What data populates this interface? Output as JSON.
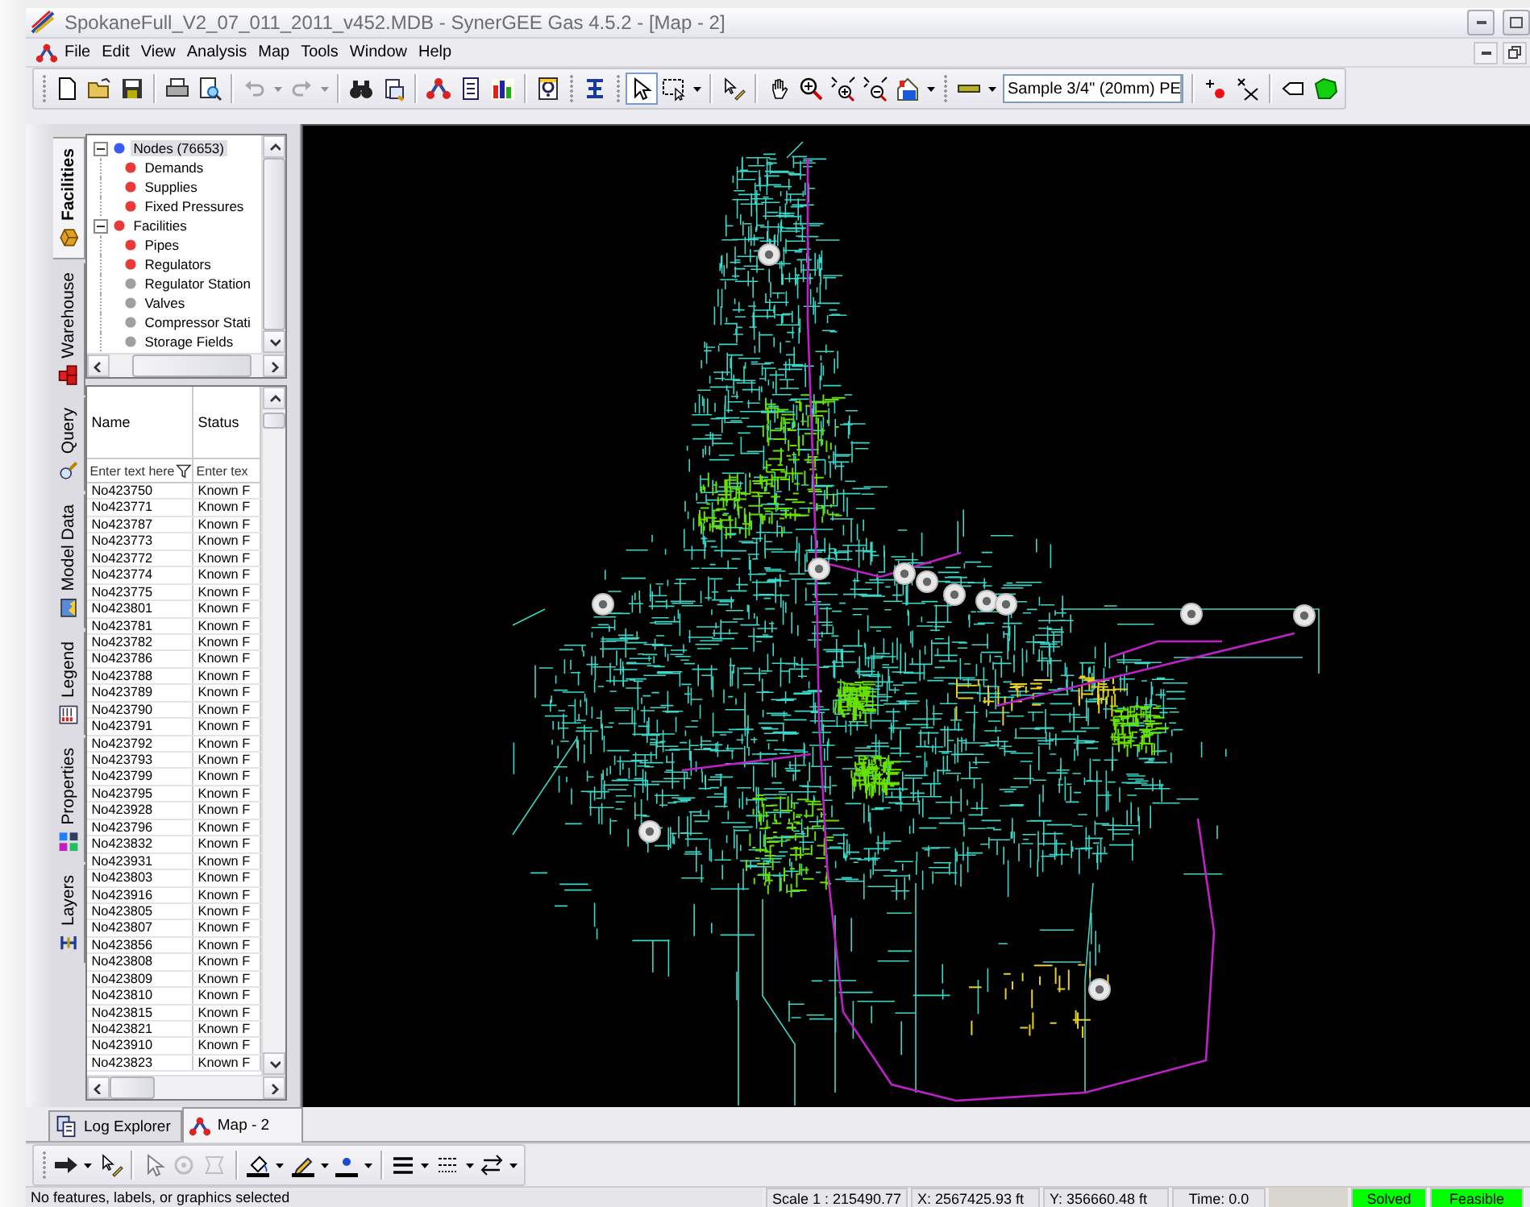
{
  "window": {
    "title": "SpokaneFull_V2_07_011_2011_v452.MDB - SynerGEE Gas 4.5.2 - [Map - 2]"
  },
  "menu": [
    "File",
    "Edit",
    "View",
    "Analysis",
    "Map",
    "Tools",
    "Window",
    "Help"
  ],
  "toolbar": [
    {
      "kind": "grip"
    },
    {
      "kind": "new",
      "disabled": false,
      "pressed": false
    },
    {
      "kind": "open",
      "disabled": false,
      "pressed": false
    },
    {
      "kind": "save",
      "disabled": false,
      "pressed": false
    },
    {
      "kind": "sep"
    },
    {
      "kind": "print",
      "disabled": false,
      "pressed": false
    },
    {
      "kind": "preview",
      "disabled": false,
      "pressed": false
    },
    {
      "kind": "sep"
    },
    {
      "kind": "undo",
      "disabled": true,
      "pressed": false
    },
    {
      "kind": "caret",
      "disabled": true,
      "pressed": false
    },
    {
      "kind": "redo",
      "disabled": true,
      "pressed": false
    },
    {
      "kind": "caret",
      "disabled": true,
      "pressed": false
    },
    {
      "kind": "sep"
    },
    {
      "kind": "binoculars",
      "disabled": false,
      "pressed": false
    },
    {
      "kind": "find-replace",
      "disabled": false,
      "pressed": false
    },
    {
      "kind": "sep"
    },
    {
      "kind": "network",
      "disabled": false,
      "pressed": false
    },
    {
      "kind": "report",
      "disabled": false,
      "pressed": false
    },
    {
      "kind": "chart",
      "disabled": false,
      "pressed": false
    },
    {
      "kind": "sep"
    },
    {
      "kind": "help",
      "disabled": false,
      "pressed": false
    },
    {
      "kind": "grip"
    },
    {
      "kind": "ibeam",
      "disabled": false,
      "pressed": false
    },
    {
      "kind": "grip"
    },
    {
      "kind": "pointer",
      "disabled": false,
      "pressed": true
    },
    {
      "kind": "select-box",
      "disabled": false,
      "pressed": false
    },
    {
      "kind": "caret",
      "disabled": false,
      "pressed": false
    },
    {
      "kind": "sep"
    },
    {
      "kind": "edit-pointer",
      "disabled": false,
      "pressed": false
    },
    {
      "kind": "sep"
    },
    {
      "kind": "pan",
      "disabled": false,
      "pressed": false
    },
    {
      "kind": "zoom-in",
      "disabled": false,
      "pressed": false
    },
    {
      "kind": "zoom-extent-in",
      "disabled": false,
      "pressed": false
    },
    {
      "kind": "zoom-extent-out",
      "disabled": false,
      "pressed": false
    },
    {
      "kind": "home",
      "disabled": false,
      "pressed": false
    },
    {
      "kind": "caret",
      "disabled": false,
      "pressed": false
    },
    {
      "kind": "grip"
    },
    {
      "kind": "pipe",
      "disabled": false,
      "pressed": false
    },
    {
      "kind": "caret",
      "disabled": false,
      "pressed": false
    },
    {
      "kind": "combo",
      "value": "Sample  3/4\" (20mm) PE"
    },
    {
      "kind": "sep"
    },
    {
      "kind": "add-node",
      "disabled": false,
      "pressed": false
    },
    {
      "kind": "delete-node",
      "disabled": false,
      "pressed": false
    },
    {
      "kind": "sep"
    },
    {
      "kind": "tag",
      "disabled": false,
      "pressed": false
    },
    {
      "kind": "polygon",
      "disabled": false,
      "pressed": false
    }
  ],
  "side_tabs": [
    {
      "label": "Facilities",
      "selected": true
    },
    {
      "label": "Warehouse",
      "selected": false
    },
    {
      "label": "Query",
      "selected": false
    },
    {
      "label": "Model Data",
      "selected": false
    },
    {
      "label": "Legend",
      "selected": false
    },
    {
      "label": "Properties",
      "selected": false
    },
    {
      "label": "Layers",
      "selected": false
    }
  ],
  "tree": [
    {
      "label": "Nodes (76653)",
      "color": "#3a5cf0",
      "expanded": true,
      "selected": true,
      "children": [
        {
          "label": "Demands",
          "color": "#e83a3a",
          "selected": false
        },
        {
          "label": "Supplies",
          "color": "#e83a3a",
          "selected": false
        },
        {
          "label": "Fixed Pressures",
          "color": "#e83a3a",
          "selected": false
        }
      ]
    },
    {
      "label": "Facilities",
      "color": "#e83a3a",
      "expanded": true,
      "selected": false,
      "children": [
        {
          "label": "Pipes",
          "color": "#e83a3a",
          "selected": false
        },
        {
          "label": "Regulators",
          "color": "#e83a3a",
          "selected": false
        },
        {
          "label": "Regulator Station",
          "color": "#a0a0a0",
          "selected": false
        },
        {
          "label": "Valves",
          "color": "#a0a0a0",
          "selected": false
        },
        {
          "label": "Compressor Stati",
          "color": "#a0a0a0",
          "selected": false
        },
        {
          "label": "Storage Fields",
          "color": "#a0a0a0",
          "selected": false
        }
      ]
    }
  ],
  "grid": {
    "columns": [
      {
        "label": "Name",
        "placeholder": "Enter text here"
      },
      {
        "label": "Status",
        "placeholder": "Enter tex"
      }
    ],
    "rows": [
      [
        "No423750",
        "Known F"
      ],
      [
        "No423771",
        "Known F"
      ],
      [
        "No423787",
        "Known F"
      ],
      [
        "No423773",
        "Known F"
      ],
      [
        "No423772",
        "Known F"
      ],
      [
        "No423774",
        "Known F"
      ],
      [
        "No423775",
        "Known F"
      ],
      [
        "No423801",
        "Known F"
      ],
      [
        "No423781",
        "Known F"
      ],
      [
        "No423782",
        "Known F"
      ],
      [
        "No423786",
        "Known F"
      ],
      [
        "No423788",
        "Known F"
      ],
      [
        "No423789",
        "Known F"
      ],
      [
        "No423790",
        "Known F"
      ],
      [
        "No423791",
        "Known F"
      ],
      [
        "No423792",
        "Known F"
      ],
      [
        "No423793",
        "Known F"
      ],
      [
        "No423799",
        "Known F"
      ],
      [
        "No423795",
        "Known F"
      ],
      [
        "No423928",
        "Known F"
      ],
      [
        "No423796",
        "Known F"
      ],
      [
        "No423832",
        "Known F"
      ],
      [
        "No423931",
        "Known F"
      ],
      [
        "No423803",
        "Known F"
      ],
      [
        "No423916",
        "Known F"
      ],
      [
        "No423805",
        "Known F"
      ],
      [
        "No423807",
        "Known F"
      ],
      [
        "No423856",
        "Known F"
      ],
      [
        "No423808",
        "Known F"
      ],
      [
        "No423809",
        "Known F"
      ],
      [
        "No423810",
        "Known F"
      ],
      [
        "No423815",
        "Known F"
      ],
      [
        "No423821",
        "Known F"
      ],
      [
        "No423910",
        "Known F"
      ],
      [
        "No423823",
        "Known F"
      ]
    ]
  },
  "doc_tabs": [
    {
      "label": "Log Explorer",
      "selected": false
    },
    {
      "label": "Map - 2",
      "selected": true
    }
  ],
  "drawing_toolbar": [
    {
      "kind": "grip"
    },
    {
      "kind": "arrow",
      "disabled": false,
      "pressed": false
    },
    {
      "kind": "caret",
      "disabled": false,
      "pressed": false
    },
    {
      "kind": "edit-pointer",
      "disabled": false,
      "pressed": false
    },
    {
      "kind": "sep"
    },
    {
      "kind": "pointer",
      "disabled": true,
      "pressed": false
    },
    {
      "kind": "rotate",
      "disabled": true,
      "pressed": false
    },
    {
      "kind": "reshape",
      "disabled": true,
      "pressed": false
    },
    {
      "kind": "sep"
    },
    {
      "kind": "fill",
      "disabled": false,
      "pressed": false
    },
    {
      "kind": "caret",
      "disabled": false,
      "pressed": false
    },
    {
      "kind": "line-color",
      "disabled": false,
      "pressed": false
    },
    {
      "kind": "caret",
      "disabled": false,
      "pressed": false
    },
    {
      "kind": "point",
      "disabled": false,
      "pressed": false
    },
    {
      "kind": "caret",
      "disabled": false,
      "pressed": false
    },
    {
      "kind": "sep"
    },
    {
      "kind": "line-weight",
      "disabled": false,
      "pressed": false
    },
    {
      "kind": "caret",
      "disabled": false,
      "pressed": false
    },
    {
      "kind": "dash",
      "disabled": false,
      "pressed": false
    },
    {
      "kind": "caret",
      "disabled": false,
      "pressed": false
    },
    {
      "kind": "arrow-style",
      "disabled": false,
      "pressed": false
    },
    {
      "kind": "caret",
      "disabled": false,
      "pressed": false
    }
  ],
  "status_bar": [
    {
      "text": "No features, labels, or graphics selected",
      "color": "#e6e5ea"
    },
    {
      "text": "Scale  1 : 215490.77",
      "color": "#e6e5ea"
    },
    {
      "text": "X: 2567425.93 ft",
      "color": "#e6e5ea"
    },
    {
      "text": "Y: 356660.48 ft",
      "color": "#e6e5ea"
    },
    {
      "text": "Time: 0.0",
      "color": "#e6e5ea"
    },
    {
      "text": "Solved",
      "color": "#00ff00"
    },
    {
      "text": "Feasible",
      "color": "#00ff00"
    }
  ]
}
